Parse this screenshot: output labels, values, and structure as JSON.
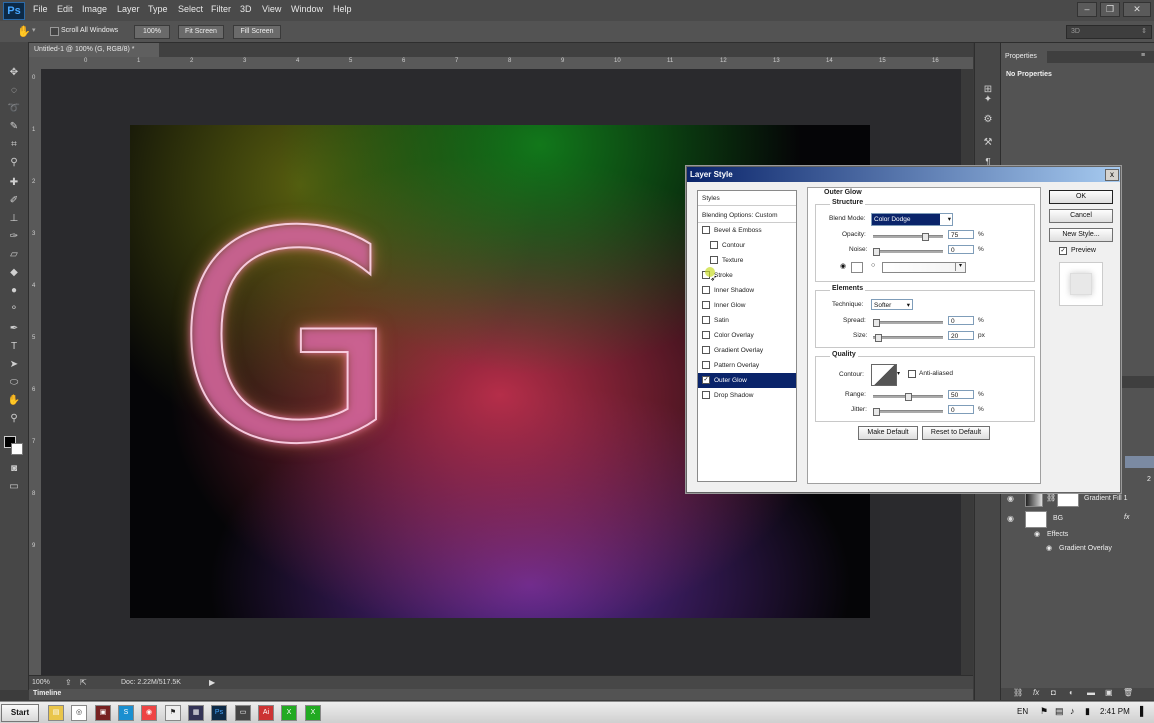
{
  "app": {
    "logo": "Ps"
  },
  "menu": [
    "File",
    "Edit",
    "Image",
    "Layer",
    "Type",
    "Select",
    "Filter",
    "3D",
    "View",
    "Window",
    "Help"
  ],
  "options": {
    "scroll_all": "Scroll All Windows",
    "zoom": "100%",
    "fit_screen": "Fit Screen",
    "fill_screen": "Fill Screen",
    "mode_3d": "3D"
  },
  "document": {
    "tab": "Untitled-1 @ 100% (G, RGB/8) *",
    "glyph": "G",
    "zoom": "100%",
    "doc_info": "Doc: 2.22M/517.5K"
  },
  "ruler_h": [
    "0",
    "1",
    "2",
    "3",
    "4",
    "5",
    "6",
    "7",
    "8",
    "9",
    "10",
    "11",
    "12",
    "13",
    "14",
    "15",
    "16"
  ],
  "ruler_v": [
    "0",
    "1",
    "2",
    "3",
    "4",
    "5",
    "6",
    "7",
    "8",
    "9"
  ],
  "timeline": "Timeline",
  "properties": {
    "tab": "Properties",
    "empty": "No Properties"
  },
  "layers": {
    "peek": "2",
    "rows": [
      {
        "name": "Gradient Fill 1"
      },
      {
        "name": "BG",
        "fx": "fx"
      },
      {
        "name": "Effects"
      },
      {
        "name": "Gradient Overlay"
      }
    ]
  },
  "dialog": {
    "title": "Layer Style",
    "close": "x",
    "styles_header": "Styles",
    "blending": "Blending Options: Custom",
    "items": [
      {
        "label": "Bevel & Emboss",
        "checked": false,
        "indent": false
      },
      {
        "label": "Contour",
        "checked": false,
        "indent": true
      },
      {
        "label": "Texture",
        "checked": false,
        "indent": true
      },
      {
        "label": "Stroke",
        "checked": false,
        "indent": false
      },
      {
        "label": "Inner Shadow",
        "checked": false,
        "indent": false
      },
      {
        "label": "Inner Glow",
        "checked": false,
        "indent": false
      },
      {
        "label": "Satin",
        "checked": false,
        "indent": false
      },
      {
        "label": "Color Overlay",
        "checked": false,
        "indent": false
      },
      {
        "label": "Gradient Overlay",
        "checked": false,
        "indent": false
      },
      {
        "label": "Pattern Overlay",
        "checked": false,
        "indent": false
      },
      {
        "label": "Outer Glow",
        "checked": true,
        "indent": false,
        "selected": true
      },
      {
        "label": "Drop Shadow",
        "checked": false,
        "indent": false
      }
    ],
    "outer_glow": "Outer Glow",
    "structure": "Structure",
    "blend_mode_label": "Blend Mode:",
    "blend_mode": "Color Dodge",
    "opacity_label": "Opacity:",
    "opacity": "75",
    "noise_label": "Noise:",
    "noise": "0",
    "pct": "%",
    "px": "px",
    "elements": "Elements",
    "technique_label": "Technique:",
    "technique": "Softer",
    "spread_label": "Spread:",
    "spread": "0",
    "size_label": "Size:",
    "size": "20",
    "quality": "Quality",
    "contour_label": "Contour:",
    "antialiased": "Anti-aliased",
    "range_label": "Range:",
    "range": "50",
    "jitter_label": "Jitter:",
    "jitter": "0",
    "make_default": "Make Default",
    "reset_default": "Reset to Default",
    "ok": "OK",
    "cancel": "Cancel",
    "new_style": "New Style...",
    "preview": "Preview"
  },
  "taskbar": {
    "start": "Start",
    "lang": "EN",
    "clock": "2:41 PM"
  }
}
